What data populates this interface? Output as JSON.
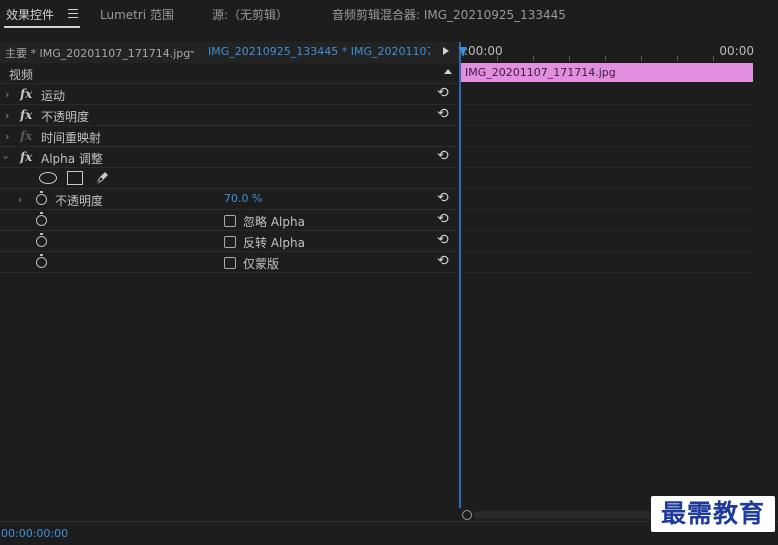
{
  "tabs": [
    {
      "label": "效果控件",
      "active": true
    },
    {
      "label": "Lumetri 范围",
      "active": false
    },
    {
      "label": "源:（无剪辑）",
      "active": false
    },
    {
      "label": "音频剪辑混合器: IMG_20210925_133445",
      "active": false
    }
  ],
  "clip_header": {
    "master": "主要 * IMG_20201107_171714.jpg",
    "sequence": "IMG_20210925_133445 * IMG_20201107_..."
  },
  "effects": {
    "section": "视频",
    "motion": "运动",
    "opacity": "不透明度",
    "time_remap": "时间重映射",
    "alpha_adjust": "Alpha 调整",
    "alpha_opacity_label": "不透明度",
    "alpha_opacity_value": "70.0 %",
    "ignore_alpha": "忽略 Alpha",
    "invert_alpha": "反转 Alpha",
    "mask_only": "仅蒙版",
    "fx_symbol": "fx"
  },
  "timeline": {
    "start_time": ":00:00",
    "end_time": "00:00",
    "clip_name": "IMG_20201107_171714.jpg",
    "clip_color": "#e38fe0"
  },
  "footer": {
    "timecode": "00:00:00:00"
  },
  "watermark": "最需教育",
  "colors": {
    "accent": "#3f8fd8",
    "background": "#1d1d1d"
  }
}
